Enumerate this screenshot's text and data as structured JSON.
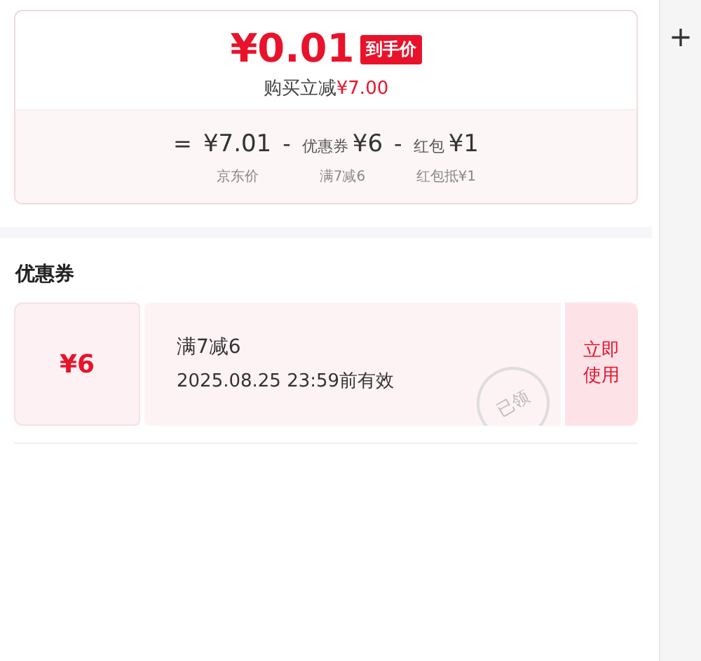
{
  "price_card": {
    "price": "¥0.01",
    "price_tag": "到手价",
    "saving_label": "购买立减",
    "saving_amount": "¥7.00",
    "formula": [
      {
        "kind": "sign",
        "text": "="
      },
      {
        "kind": "term",
        "value": "¥7.01",
        "caption": "京东价"
      },
      {
        "kind": "sign",
        "text": "-"
      },
      {
        "kind": "term",
        "label": "优惠券",
        "value": "¥6",
        "caption": "满7减6"
      },
      {
        "kind": "sign",
        "text": "-"
      },
      {
        "kind": "term",
        "label": "红包",
        "value": "¥1",
        "caption": "红包抵¥1"
      }
    ]
  },
  "coupons_section": {
    "title": "优惠券",
    "coupons": [
      {
        "amount": "¥6",
        "title": "满7减6",
        "validity": "2025.08.25 23:59前有效",
        "stamp": "已领",
        "action": "立即使用"
      }
    ]
  },
  "side_panel": {
    "add_button": "+"
  }
}
